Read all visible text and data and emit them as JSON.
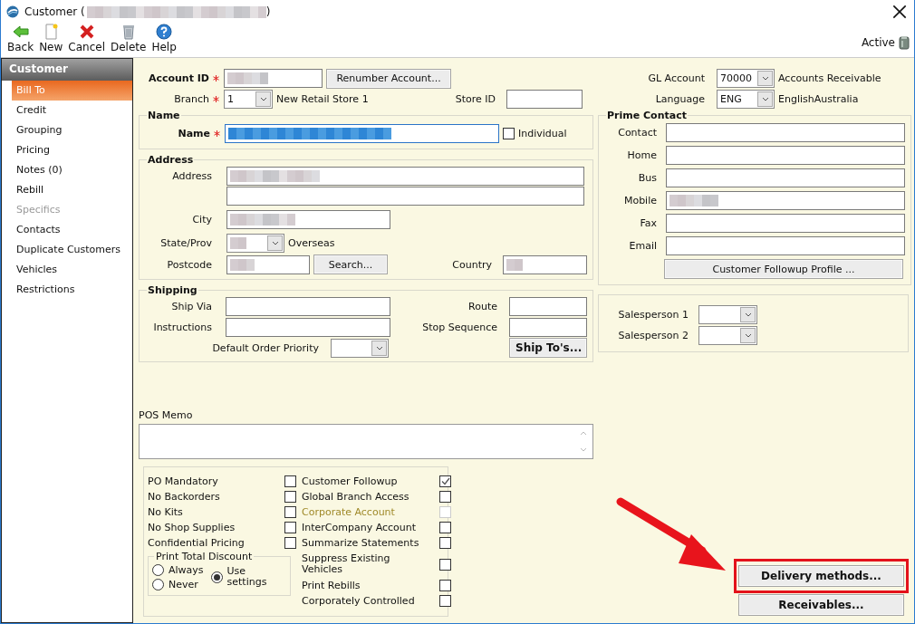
{
  "window": {
    "title": "Customer (",
    "title_redacted": true,
    "title_end": ")"
  },
  "toolbar": [
    {
      "label": "Back",
      "kind": "back"
    },
    {
      "label": "New",
      "kind": "new"
    },
    {
      "label": "Cancel",
      "kind": "cancel"
    },
    {
      "label": "Delete",
      "kind": "delete"
    },
    {
      "label": "Help",
      "kind": "help"
    }
  ],
  "status": {
    "label": "Active"
  },
  "sidebar": {
    "title": "Customer",
    "items": [
      {
        "label": "Bill To",
        "selected": true,
        "disabled": false
      },
      {
        "label": "Credit",
        "selected": false,
        "disabled": false
      },
      {
        "label": "Grouping",
        "selected": false,
        "disabled": false
      },
      {
        "label": "Pricing",
        "selected": false,
        "disabled": false
      },
      {
        "label": "Notes (0)",
        "selected": false,
        "disabled": false
      },
      {
        "label": "Rebill",
        "selected": false,
        "disabled": false
      },
      {
        "label": "Specifics",
        "selected": false,
        "disabled": true
      },
      {
        "label": "Contacts",
        "selected": false,
        "disabled": false
      },
      {
        "label": "Duplicate Customers",
        "selected": false,
        "disabled": false
      },
      {
        "label": "Vehicles",
        "selected": false,
        "disabled": false
      },
      {
        "label": "Restrictions",
        "selected": false,
        "disabled": false
      }
    ]
  },
  "account_id": {
    "label": "Account ID",
    "required": true,
    "redacted": true
  },
  "renumber_button": "Renumber Account...",
  "branch": {
    "label": "Branch",
    "required": true,
    "value": "1",
    "description": "New Retail Store 1"
  },
  "store_id": {
    "label": "Store ID"
  },
  "gl_account": {
    "label": "GL Account",
    "value": "70000",
    "description": "Accounts Receivable"
  },
  "language": {
    "label": "Language",
    "value": "ENG",
    "description": "EnglishAustralia"
  },
  "name_group": {
    "title": "Name",
    "name": {
      "label": "Name",
      "required": true,
      "redacted": true,
      "selected": true
    },
    "individual": {
      "label": "Individual",
      "checked": false
    }
  },
  "address_group": {
    "title": "Address",
    "address_lines": [
      {
        "label": "Address",
        "redacted": true
      },
      {
        "redacted": false
      }
    ],
    "city": {
      "label": "City",
      "redacted": true
    },
    "state": {
      "label": "State/Prov",
      "redacted": true,
      "description": "Overseas"
    },
    "postcode": {
      "label": "Postcode",
      "redacted": true
    },
    "search_button": "Search...",
    "country": {
      "label": "Country",
      "redacted": true
    }
  },
  "shipping_group": {
    "title": "Shipping",
    "ship_via": {
      "label": "Ship Via"
    },
    "instructions": {
      "label": "Instructions"
    },
    "default_order_priority": {
      "label": "Default Order Priority"
    },
    "route": {
      "label": "Route"
    },
    "stop_sequence": {
      "label": "Stop Sequence"
    },
    "ship_tos_button": "Ship To's..."
  },
  "prime_contact": {
    "title": "Prime Contact",
    "fields": [
      {
        "label": "Contact",
        "redacted": false
      },
      {
        "label": "Home",
        "redacted": false
      },
      {
        "label": "Bus",
        "redacted": false
      },
      {
        "label": "Mobile",
        "redacted": true
      },
      {
        "label": "Fax",
        "redacted": false
      },
      {
        "label": "Email",
        "redacted": false
      }
    ],
    "followup_button": "Customer Followup Profile ..."
  },
  "salespeople": [
    {
      "label": "Salesperson 1"
    },
    {
      "label": "Salesperson 2"
    }
  ],
  "pos_memo": {
    "label": "POS Memo"
  },
  "flags_left": [
    {
      "label": "PO Mandatory",
      "checked": false,
      "disabled": false
    },
    {
      "label": "No Backorders",
      "checked": false,
      "disabled": false
    },
    {
      "label": "No Kits",
      "checked": false,
      "disabled": false
    },
    {
      "label": "No Shop Supplies",
      "checked": false,
      "disabled": false
    },
    {
      "label": "Confidential Pricing",
      "checked": false,
      "disabled": false
    }
  ],
  "print_total_discount": {
    "title": "Print Total Discount",
    "options": [
      {
        "label": "Always",
        "selected": false
      },
      {
        "label": "Never",
        "selected": false
      },
      {
        "label": "Use settings",
        "selected": true
      }
    ]
  },
  "flags_right": [
    {
      "label": "Customer Followup",
      "checked": true,
      "disabled": false
    },
    {
      "label": "Global Branch Access",
      "checked": false,
      "disabled": false
    },
    {
      "label": "Corporate Account",
      "checked": false,
      "disabled": true
    },
    {
      "label": "InterCompany Account",
      "checked": false,
      "disabled": false
    },
    {
      "label": "Summarize Statements",
      "checked": false,
      "disabled": false
    },
    {
      "label": "Suppress Existing Vehicles",
      "checked": false,
      "disabled": false
    },
    {
      "label": "Print Rebills",
      "checked": false,
      "disabled": false
    },
    {
      "label": "Corporately Controlled",
      "checked": false,
      "disabled": false
    }
  ],
  "buttons": [
    {
      "label": "Delivery methods...",
      "highlighted": true
    },
    {
      "label": "Receivables...",
      "highlighted": false
    }
  ]
}
